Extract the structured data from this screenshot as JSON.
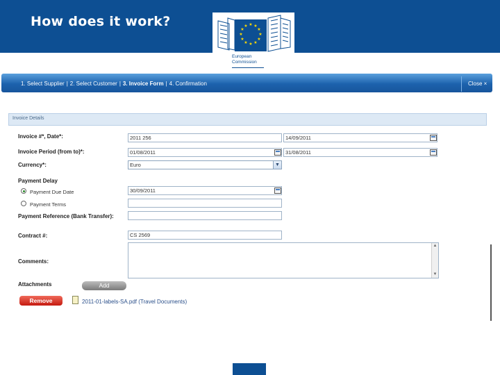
{
  "slide": {
    "title": "How does it work?",
    "logo_text": [
      "European",
      "Commission"
    ],
    "brand_color": "#0d4f93"
  },
  "steps": {
    "step1": "1. Select Supplier",
    "step2": "2. Select Customer",
    "step3": "3. Invoice Form",
    "step4": "4. Confirmation",
    "separator": "|",
    "close": "Close ×"
  },
  "section_title": "Invoice Details",
  "form": {
    "invoice_label": "Invoice #*, Date*:",
    "invoice_number": "2011 256",
    "invoice_date": "14/09/2011",
    "period_label": "Invoice Period (from to)*:",
    "period_from": "01/08/2011",
    "period_to": "31/08/2011",
    "currency_label": "Currency*:",
    "currency_value": "Euro",
    "payment_delay_label": "Payment Delay",
    "due_date_option": "Payment Due Date",
    "due_date_value": "30/09/2011",
    "terms_option": "Payment Terms",
    "terms_value": "",
    "reference_label": "Payment Reference (Bank Transfer):",
    "reference_value": "",
    "contract_label": "Contract #:",
    "contract_value": "CS 2569",
    "comments_label": "Comments:",
    "comments_value": "",
    "attachments_label": "Attachments",
    "add_label": "Add",
    "remove_label": "Remove",
    "attachment_file": "2011-01-labels-SA.pdf (Travel Documents)"
  },
  "icons": {
    "calendar": "calendar-icon",
    "dropdown": "chevron-down-icon",
    "file": "document-icon"
  }
}
